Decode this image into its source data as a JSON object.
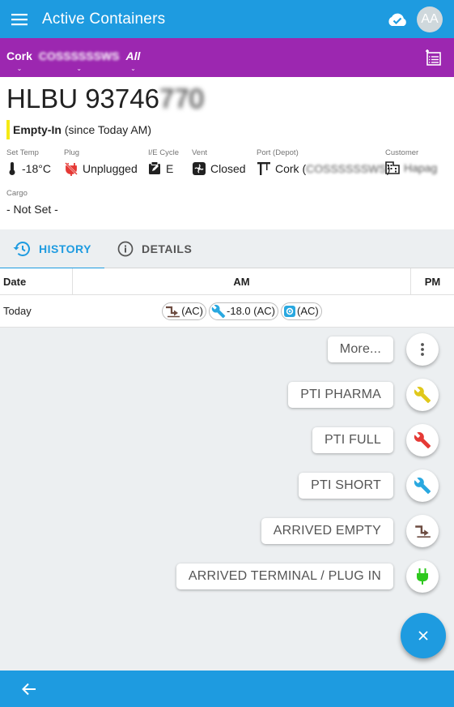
{
  "appbar": {
    "title": "Active Containers",
    "avatar_initials": "AA"
  },
  "filters": {
    "location": "Cork",
    "customer": "COSSSSSSWS",
    "scope": "All"
  },
  "container": {
    "number_visible": "HLBU 93746",
    "number_obscured": "770",
    "status_bold": "Empty-In",
    "status_rest": "(since Today AM)",
    "status_color": "#f5ea14"
  },
  "attributes": {
    "set_temp": {
      "label": "Set Temp",
      "value": "-18°C"
    },
    "plug": {
      "label": "Plug",
      "value": "Unplugged"
    },
    "ie_cycle": {
      "label": "I/E Cycle",
      "value": "E"
    },
    "vent": {
      "label": "Vent",
      "value": "Closed"
    },
    "port": {
      "label": "Port (Depot)",
      "value_prefix": "Cork (",
      "value_obscured": "COSSSSSSWS",
      "value_suffix": ")"
    },
    "customer": {
      "label": "Customer",
      "value": "Hapag"
    },
    "cargo": {
      "label": "Cargo",
      "value": "- Not Set -"
    }
  },
  "tabs": [
    {
      "label": "HISTORY",
      "icon": "history-icon",
      "active": true
    },
    {
      "label": "DETAILS",
      "icon": "info-icon",
      "active": false
    }
  ],
  "history_table": {
    "headers": {
      "date": "Date",
      "am": "AM",
      "pm": "PM"
    },
    "rows": [
      {
        "date": "Today",
        "chips": [
          {
            "icon": "arrived-empty-icon",
            "text": "(AC)"
          },
          {
            "icon": "wrench-icon",
            "text": "-18.0 (AC)"
          },
          {
            "icon": "gear-icon",
            "text": "(AC)"
          }
        ]
      }
    ]
  },
  "speed_dial": [
    {
      "label": "More...",
      "icon": "more-vert-icon",
      "color": "#555555"
    },
    {
      "label": "PTI PHARMA",
      "icon": "wrench-icon",
      "color": "#e0c81a"
    },
    {
      "label": "PTI FULL",
      "icon": "wrench-icon",
      "color": "#e53935"
    },
    {
      "label": "PTI SHORT",
      "icon": "wrench-icon",
      "color": "#29a8e0"
    },
    {
      "label": "ARRIVED EMPTY",
      "icon": "arrived-empty-icon",
      "color": "#6d4c41"
    },
    {
      "label": "ARRIVED TERMINAL / PLUG IN",
      "icon": "plug-icon",
      "color": "#2ec81e"
    }
  ],
  "colors": {
    "primary": "#1e9be0",
    "filterbar": "#9c27b0",
    "background": "#eceff1"
  }
}
